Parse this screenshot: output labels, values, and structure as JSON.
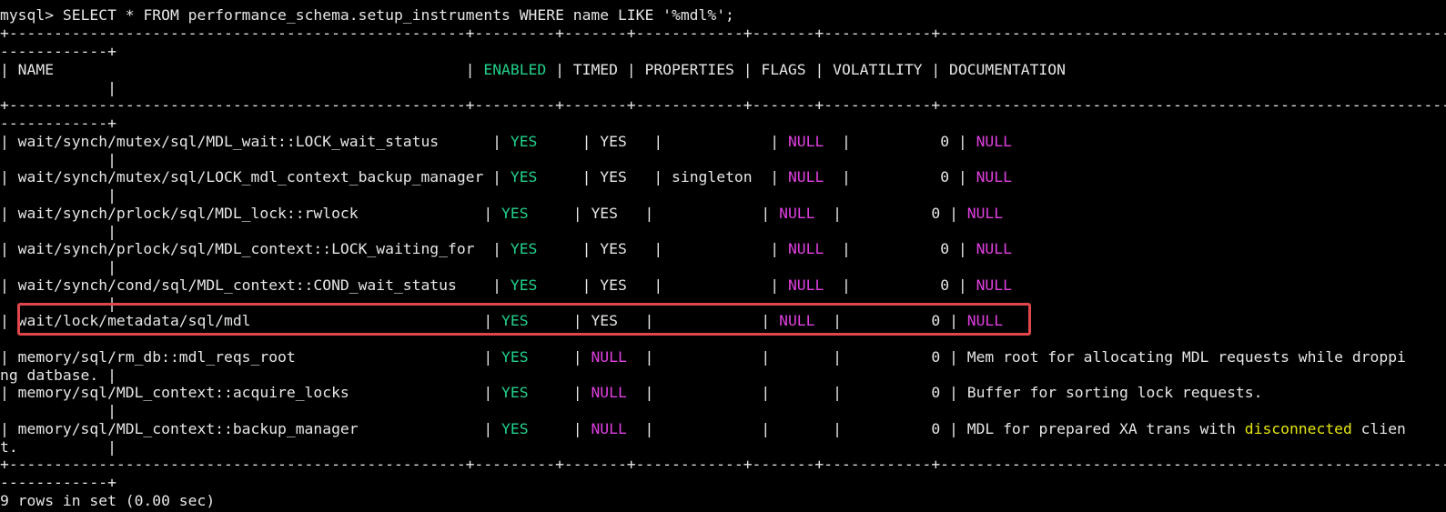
{
  "terminal": {
    "prompt": "mysql> ",
    "command": "SELECT * FROM performance_schema.setup_instruments WHERE name LIKE '%mdl%';",
    "border_a": "+---------------------------------------------------+---------+-------+------------+-------+------------+------------------------------------------------------------",
    "border_b": "------------+",
    "pipe_wrap": "            |",
    "header": {
      "c1": "| NAME                                              | ",
      "enabled": "ENABLED",
      "rest": " | TIMED | PROPERTIES | FLAGS | VOLATILITY | DOCUMENTATION"
    },
    "rows": [
      {
        "name_cell": "| wait/synch/mutex/sql/MDL_wait::LOCK_wait_status      | ",
        "enabled": "YES",
        "sep1": "     | ",
        "timed": "YES",
        "props": "   |            | ",
        "flags": "NULL",
        "vol": "  |          0 | ",
        "doc": "NULL",
        "doc_tail": "",
        "wrap": "            |"
      },
      {
        "name_cell": "| wait/synch/mutex/sql/LOCK_mdl_context_backup_manager | ",
        "enabled": "YES",
        "sep1": "     | ",
        "timed": "YES",
        "props": "   | singleton  | ",
        "flags": "NULL",
        "vol": "  |          0 | ",
        "doc": "NULL",
        "doc_tail": "",
        "wrap": "            |"
      },
      {
        "name_cell": "| wait/synch/prlock/sql/MDL_lock::rwlock              | ",
        "enabled": "YES",
        "sep1": "     | ",
        "timed": "YES",
        "props": "   |            | ",
        "flags": "NULL",
        "vol": "  |          0 | ",
        "doc": "NULL",
        "doc_tail": "",
        "wrap": "            |"
      },
      {
        "name_cell": "| wait/synch/prlock/sql/MDL_context::LOCK_waiting_for  | ",
        "enabled": "YES",
        "sep1": "     | ",
        "timed": "YES",
        "props": "   |            | ",
        "flags": "NULL",
        "vol": "  |          0 | ",
        "doc": "NULL",
        "doc_tail": "",
        "wrap": "            |"
      },
      {
        "name_cell": "| wait/synch/cond/sql/MDL_context::COND_wait_status    | ",
        "enabled": "YES",
        "sep1": "     | ",
        "timed": "YES",
        "props": "   |            | ",
        "flags": "NULL",
        "vol": "  |          0 | ",
        "doc": "NULL",
        "doc_tail": "",
        "wrap": "            |"
      },
      {
        "name_cell": "| wait/lock/metadata/sql/mdl                          | ",
        "enabled": "YES",
        "sep1": "     | ",
        "timed": "YES",
        "props": "   |            | ",
        "flags": "NULL",
        "vol": "  |          0 | ",
        "doc": "NULL",
        "doc_tail": "",
        "wrap": ""
      },
      {
        "name_cell": "| memory/sql/rm_db::mdl_reqs_root                     | ",
        "enabled": "YES",
        "sep1": "     | ",
        "timed": "NULL",
        "props": "  |            |       |          0 | Mem root for allocating MDL requests while droppi",
        "flags": "",
        "vol": "",
        "doc": "",
        "doc_tail": "",
        "wrap": "ng datbase. |"
      },
      {
        "name_cell": "| memory/sql/MDL_context::acquire_locks               | ",
        "enabled": "YES",
        "sep1": "     | ",
        "timed": "NULL",
        "props": "  |            |       |          0 | Buffer for sorting lock requests.",
        "flags": "",
        "vol": "",
        "doc": "",
        "doc_tail": "",
        "wrap": "            |"
      },
      {
        "name_cell": "| memory/sql/MDL_context::backup_manager              | ",
        "enabled": "YES",
        "sep1": "     | ",
        "timed": "NULL",
        "props": "  |            |       |          0 | MDL for prepared XA trans with ",
        "flags": "",
        "vol": "",
        "doc": "disconnected",
        "doc_tail": " clien",
        "wrap": "t.          |"
      }
    ],
    "footer": "9 rows in set (0.00 sec)",
    "colors": {
      "background": "#000000",
      "text": "#e6e6e6",
      "enabled_yes": "#23d18b",
      "null": "#e040e0",
      "highlight_word": "#e5e510",
      "annotation_box": "#e0474c"
    }
  }
}
